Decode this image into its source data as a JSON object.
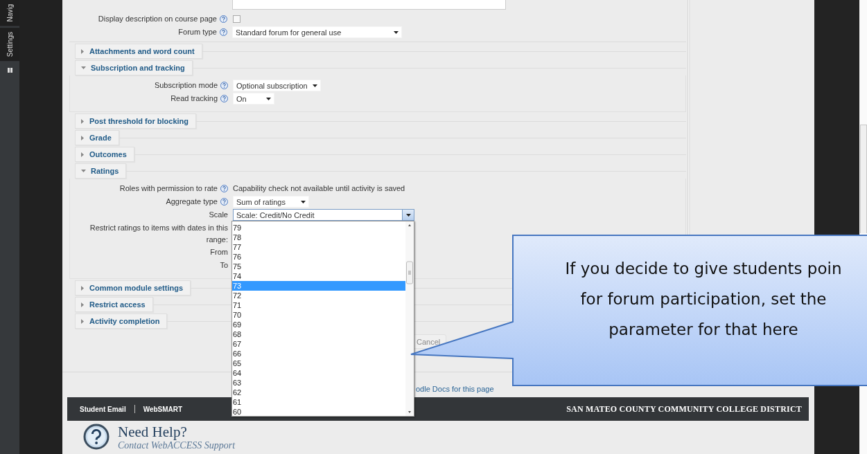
{
  "sidebar": {
    "tabs": [
      {
        "label": "Navig"
      },
      {
        "label": "Settings"
      }
    ]
  },
  "form": {
    "top_rows": [
      {
        "kind": "checkbox",
        "label": "Display description on course page",
        "help": true,
        "checked": false
      },
      {
        "kind": "select",
        "label": "Forum type",
        "help": true,
        "value": "Standard forum for general use"
      }
    ],
    "sections": [
      {
        "title": "Attachments and word count",
        "expanded": false
      },
      {
        "title": "Subscription and tracking",
        "expanded": true,
        "rows": [
          {
            "kind": "select",
            "label": "Subscription mode",
            "help": true,
            "value": "Optional subscription"
          },
          {
            "kind": "select",
            "label": "Read tracking",
            "help": true,
            "value": "On"
          }
        ]
      },
      {
        "title": "Post threshold for blocking",
        "expanded": false
      },
      {
        "title": "Grade",
        "expanded": false
      },
      {
        "title": "Outcomes",
        "expanded": false
      },
      {
        "title": "Ratings",
        "expanded": true,
        "rows": [
          {
            "kind": "text",
            "label": "Roles with permission to rate",
            "help": true,
            "value": "Capability check not available until activity is saved"
          },
          {
            "kind": "select",
            "label": "Aggregate type",
            "help": true,
            "value": "Sum of ratings"
          },
          {
            "kind": "select",
            "label": "Scale",
            "help": false,
            "value": "Scale: Credit/No Credit",
            "open": true,
            "options": [
              {
                "label": "79",
                "selected": false
              },
              {
                "label": "78",
                "selected": false
              },
              {
                "label": "77",
                "selected": false
              },
              {
                "label": "76",
                "selected": false
              },
              {
                "label": "75",
                "selected": false
              },
              {
                "label": "74",
                "selected": false
              },
              {
                "label": "73",
                "selected": true
              },
              {
                "label": "72",
                "selected": false
              },
              {
                "label": "71",
                "selected": false
              },
              {
                "label": "70",
                "selected": false
              },
              {
                "label": "69",
                "selected": false
              },
              {
                "label": "68",
                "selected": false
              },
              {
                "label": "67",
                "selected": false
              },
              {
                "label": "66",
                "selected": false
              },
              {
                "label": "65",
                "selected": false
              },
              {
                "label": "64",
                "selected": false
              },
              {
                "label": "63",
                "selected": false
              },
              {
                "label": "62",
                "selected": false
              },
              {
                "label": "61",
                "selected": false
              },
              {
                "label": "60",
                "selected": false
              }
            ]
          },
          {
            "kind": "label",
            "label": "Restrict ratings to items with dates in this range:",
            "help": false
          },
          {
            "kind": "label",
            "label": "From",
            "help": false
          },
          {
            "kind": "label",
            "label": "To",
            "help": false
          }
        ]
      },
      {
        "title": "Common module settings",
        "expanded": false
      },
      {
        "title": "Restrict access",
        "expanded": false
      },
      {
        "title": "Activity completion",
        "expanded": false
      }
    ],
    "buttons": [
      {
        "label": "Cancel"
      }
    ]
  },
  "docs_link": "odle Docs for this page",
  "footer": {
    "links": [
      "Student Email",
      "WebSMART"
    ],
    "district": "SAN MATEO COUNTY COMMUNITY COLLEGE DISTRICT"
  },
  "help_block": {
    "title": "Need Help?",
    "subtitle": "Contact WebACCESS Support"
  },
  "callout": {
    "text": "If you decide to give students poin\nfor forum participation, set the\nparameter for that here"
  }
}
